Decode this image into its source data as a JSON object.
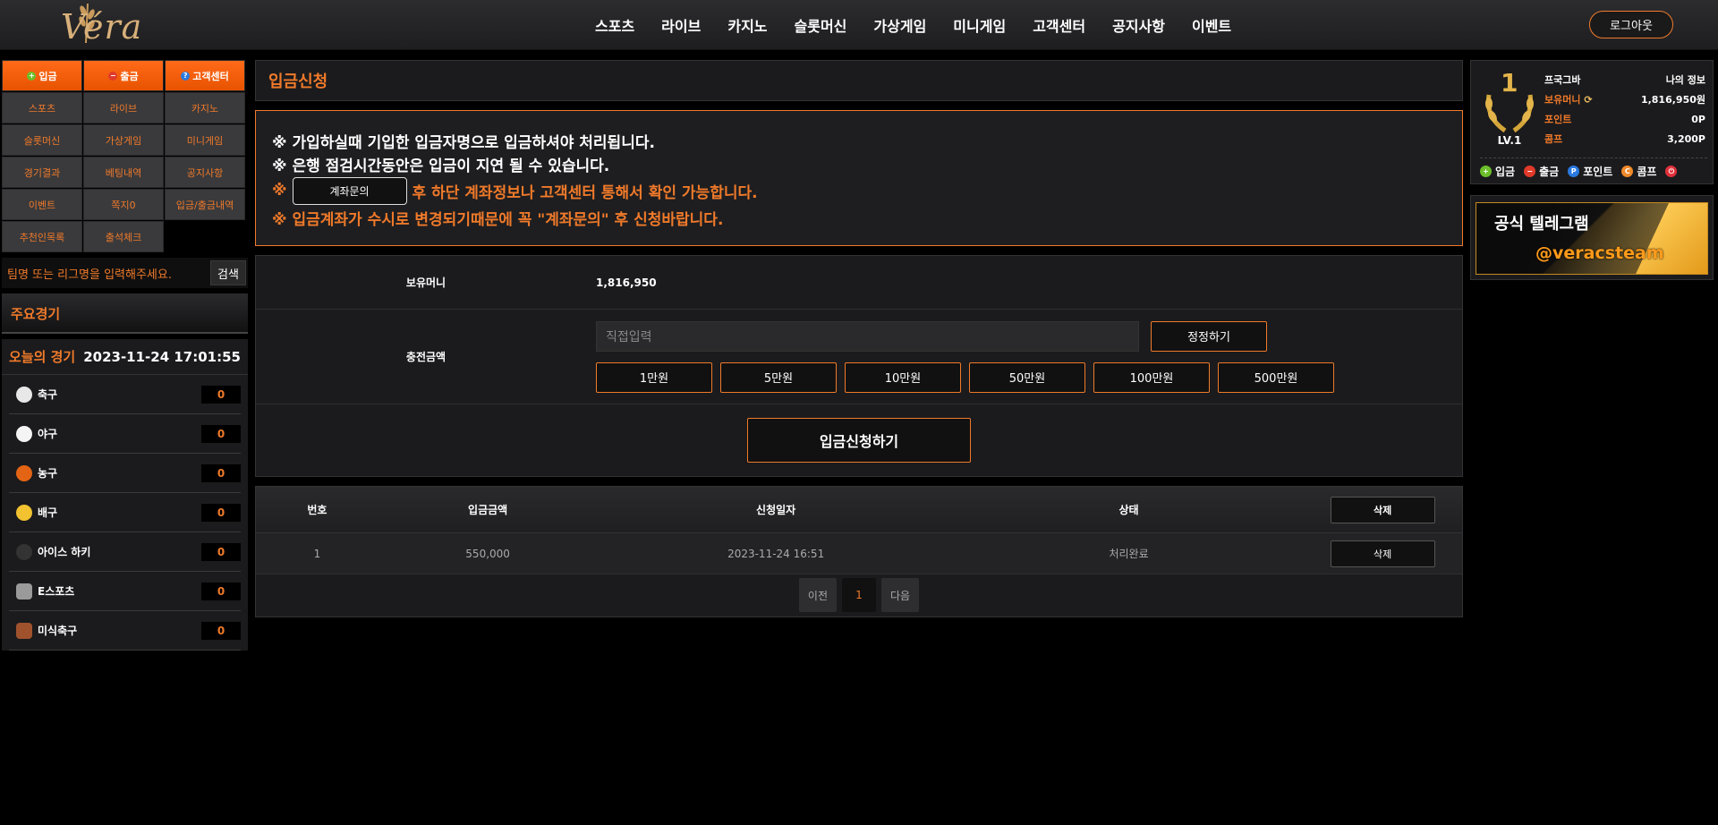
{
  "header": {
    "logo_text": "Véra",
    "nav": [
      "스포츠",
      "라이브",
      "카지노",
      "슬롯머신",
      "가상게임",
      "미니게임",
      "고객센터",
      "공지사항",
      "이벤트"
    ],
    "logout_label": "로그아웃"
  },
  "sidebar": {
    "top_buttons": [
      "입금",
      "출금",
      "고객센터"
    ],
    "menu": [
      "스포츠",
      "라이브",
      "카지노",
      "슬롯머신",
      "가상게임",
      "미니게임",
      "경기결과",
      "베팅내역",
      "공지사항",
      "이벤트",
      "쪽지0",
      "입금/출금내역",
      "추천인목록",
      "출석체크"
    ],
    "search_placeholder": "팀명 또는 리그명을 입력해주세요.",
    "search_button": "검색",
    "major_games_title": "주요경기",
    "today_title": "오늘의 경기",
    "today_datetime": "2023-11-24 17:01:55",
    "sports": [
      {
        "name": "축구",
        "count": "0",
        "icon": "soccer-ball-icon",
        "color": "#e8e8e8"
      },
      {
        "name": "야구",
        "count": "0",
        "icon": "baseball-icon",
        "color": "#f4f4f4"
      },
      {
        "name": "농구",
        "count": "0",
        "icon": "basketball-icon",
        "color": "#e36414"
      },
      {
        "name": "배구",
        "count": "0",
        "icon": "volleyball-icon",
        "color": "#f2c230"
      },
      {
        "name": "아이스 하키",
        "count": "0",
        "icon": "hockey-puck-icon",
        "color": "#333333"
      },
      {
        "name": "E스포츠",
        "count": "0",
        "icon": "gamepad-icon",
        "color": "#9a9a9a"
      },
      {
        "name": "미식축구",
        "count": "0",
        "icon": "american-football-icon",
        "color": "#a0522d"
      }
    ]
  },
  "main": {
    "page_title": "입금신청",
    "notice": {
      "line1": "※ 가입하실때 기입한 입금자명으로 입금하셔야 처리됩니다.",
      "line2": "※ 은행 점검시간동안은 입금이 지연 될 수 있습니다.",
      "line3_prefix": "※",
      "account_inquiry_button": "계좌문의",
      "line3_suffix": "후 하단 계좌정보나 고객센터 통해서 확인 가능합니다.",
      "line4": "※ 입금계좌가 수시로 변경되기때문에 꼭 \"계좌문의\" 후 신청바랍니다."
    },
    "form": {
      "holding_label": "보유머니",
      "holding_value": "1,816,950",
      "charge_label": "충전금액",
      "amount_placeholder": "직접입력",
      "reset_button": "정정하기",
      "amount_buttons": [
        "1만원",
        "5만원",
        "10만원",
        "50만원",
        "100만원",
        "500만원"
      ],
      "submit_button": "입금신청하기"
    },
    "table": {
      "headers": [
        "번호",
        "입금금액",
        "신청일자",
        "상태"
      ],
      "header_delete_button": "삭제",
      "rows": [
        {
          "no": "1",
          "amount": "550,000",
          "date": "2023-11-24 16:51",
          "status": "처리완료",
          "delete": "삭제"
        }
      ],
      "pager": {
        "prev": "이전",
        "current": "1",
        "next": "다음"
      }
    }
  },
  "user": {
    "rank_number": "1",
    "level": "LV.1",
    "name": "프국그바",
    "my_info": "나의 정보",
    "money_label": "보유머니",
    "money_value": "1,816,950원",
    "point_label": "포인트",
    "point_value": "0P",
    "comp_label": "콤프",
    "comp_value": "3,200P",
    "quick_links": [
      {
        "label": "입금",
        "icon": "plus-icon",
        "color": "#6cbf2a"
      },
      {
        "label": "출금",
        "icon": "minus-icon",
        "color": "#e03a2a"
      },
      {
        "label": "포인트",
        "icon": "point-icon",
        "color": "#2a7ae0"
      },
      {
        "label": "콤프",
        "icon": "comp-icon",
        "color": "#f08a2a"
      },
      {
        "label": "",
        "icon": "power-icon",
        "color": "#e0303a"
      }
    ]
  },
  "banner": {
    "title": "공식 텔레그램",
    "handle": "@veracsteam"
  },
  "colors": {
    "accent": "#f07a2a"
  }
}
